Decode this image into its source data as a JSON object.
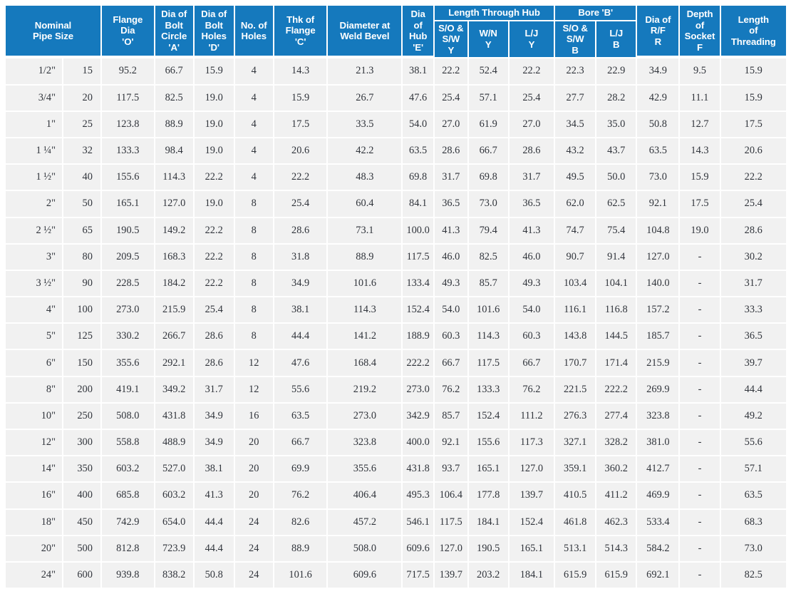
{
  "table": {
    "header": {
      "nominal_pipe_size": "Nominal\nPipe Size",
      "nominal_pipe_size_line1": "Nominal",
      "nominal_pipe_size_line2": "Pipe Size",
      "flange_dia": "Flange\nDia\n'O'",
      "flange_dia_l1": "Flange",
      "flange_dia_l2": "Dia",
      "flange_dia_l3": "'O'",
      "bolt_circle_l1": "Dia of",
      "bolt_circle_l2": "Bolt",
      "bolt_circle_l3": "Circle",
      "bolt_circle_l4": "'A'",
      "bolt_holes_l1": "Dia of",
      "bolt_holes_l2": "Bolt",
      "bolt_holes_l3": "Holes",
      "bolt_holes_l4": "'D'",
      "no_holes_l1": "No. of",
      "no_holes_l2": "Holes",
      "thk_flange_l1": "Thk of",
      "thk_flange_l2": "Flange",
      "thk_flange_l3": "'C'",
      "weld_bevel_l1": "Diameter at",
      "weld_bevel_l2": "Weld Bevel",
      "dia_hub_l1": "Dia",
      "dia_hub_l2": "of",
      "dia_hub_l3": "Hub",
      "dia_hub_l4": "'E'",
      "length_through_hub_group": "Length Through Hub",
      "bore_group": "Bore 'B'",
      "lth_sosw_l1": "S/O &",
      "lth_sosw_l2": "S/W",
      "lth_sosw_l3": "Y",
      "lth_wn_l1": "W/N",
      "lth_wn_l2": "Y",
      "lth_lj_l1": "L/J",
      "lth_lj_l2": "Y",
      "bore_sosw_l1": "S/O &",
      "bore_sosw_l2": "S/W",
      "bore_sosw_l3": "B",
      "bore_lj_l1": "L/J",
      "bore_lj_l2": "B",
      "rf_l1": "Dia of",
      "rf_l2": "R/F",
      "rf_l3": "R",
      "socket_l1": "Depth",
      "socket_l2": "of",
      "socket_l3": "Socket",
      "socket_l4": "F",
      "thread_l1": "Length",
      "thread_l2": "of",
      "thread_l3": "Threading"
    },
    "columns": [
      "Nominal Pipe Size (inch)",
      "Nominal Pipe Size (mm)",
      "Flange Dia 'O'",
      "Dia of Bolt Circle 'A'",
      "Dia of Bolt Holes 'D'",
      "No. of Holes",
      "Thk of Flange 'C'",
      "Diameter at Weld Bevel",
      "Dia of Hub 'E'",
      "Length Through Hub S/O & S/W Y",
      "Length Through Hub W/N Y",
      "Length Through Hub L/J Y",
      "Bore 'B' S/O & S/W B",
      "Bore 'B' L/J B",
      "Dia of R/F R",
      "Depth of Socket F",
      "Length of Threading"
    ],
    "rows": [
      [
        "1/2\"",
        "15",
        "95.2",
        "66.7",
        "15.9",
        "4",
        "14.3",
        "21.3",
        "38.1",
        "22.2",
        "52.4",
        "22.2",
        "22.3",
        "22.9",
        "34.9",
        "9.5",
        "15.9"
      ],
      [
        "3/4\"",
        "20",
        "117.5",
        "82.5",
        "19.0",
        "4",
        "15.9",
        "26.7",
        "47.6",
        "25.4",
        "57.1",
        "25.4",
        "27.7",
        "28.2",
        "42.9",
        "11.1",
        "15.9"
      ],
      [
        "1\"",
        "25",
        "123.8",
        "88.9",
        "19.0",
        "4",
        "17.5",
        "33.5",
        "54.0",
        "27.0",
        "61.9",
        "27.0",
        "34.5",
        "35.0",
        "50.8",
        "12.7",
        "17.5"
      ],
      [
        "1 ¼\"",
        "32",
        "133.3",
        "98.4",
        "19.0",
        "4",
        "20.6",
        "42.2",
        "63.5",
        "28.6",
        "66.7",
        "28.6",
        "43.2",
        "43.7",
        "63.5",
        "14.3",
        "20.6"
      ],
      [
        "1 ½\"",
        "40",
        "155.6",
        "114.3",
        "22.2",
        "4",
        "22.2",
        "48.3",
        "69.8",
        "31.7",
        "69.8",
        "31.7",
        "49.5",
        "50.0",
        "73.0",
        "15.9",
        "22.2"
      ],
      [
        "2\"",
        "50",
        "165.1",
        "127.0",
        "19.0",
        "8",
        "25.4",
        "60.4",
        "84.1",
        "36.5",
        "73.0",
        "36.5",
        "62.0",
        "62.5",
        "92.1",
        "17.5",
        "25.4"
      ],
      [
        "2 ½\"",
        "65",
        "190.5",
        "149.2",
        "22.2",
        "8",
        "28.6",
        "73.1",
        "100.0",
        "41.3",
        "79.4",
        "41.3",
        "74.7",
        "75.4",
        "104.8",
        "19.0",
        "28.6"
      ],
      [
        "3\"",
        "80",
        "209.5",
        "168.3",
        "22.2",
        "8",
        "31.8",
        "88.9",
        "117.5",
        "46.0",
        "82.5",
        "46.0",
        "90.7",
        "91.4",
        "127.0",
        "-",
        "30.2"
      ],
      [
        "3 ½\"",
        "90",
        "228.5",
        "184.2",
        "22.2",
        "8",
        "34.9",
        "101.6",
        "133.4",
        "49.3",
        "85.7",
        "49.3",
        "103.4",
        "104.1",
        "140.0",
        "-",
        "31.7"
      ],
      [
        "4\"",
        "100",
        "273.0",
        "215.9",
        "25.4",
        "8",
        "38.1",
        "114.3",
        "152.4",
        "54.0",
        "101.6",
        "54.0",
        "116.1",
        "116.8",
        "157.2",
        "-",
        "33.3"
      ],
      [
        "5\"",
        "125",
        "330.2",
        "266.7",
        "28.6",
        "8",
        "44.4",
        "141.2",
        "188.9",
        "60.3",
        "114.3",
        "60.3",
        "143.8",
        "144.5",
        "185.7",
        "-",
        "36.5"
      ],
      [
        "6\"",
        "150",
        "355.6",
        "292.1",
        "28.6",
        "12",
        "47.6",
        "168.4",
        "222.2",
        "66.7",
        "117.5",
        "66.7",
        "170.7",
        "171.4",
        "215.9",
        "-",
        "39.7"
      ],
      [
        "8\"",
        "200",
        "419.1",
        "349.2",
        "31.7",
        "12",
        "55.6",
        "219.2",
        "273.0",
        "76.2",
        "133.3",
        "76.2",
        "221.5",
        "222.2",
        "269.9",
        "-",
        "44.4"
      ],
      [
        "10\"",
        "250",
        "508.0",
        "431.8",
        "34.9",
        "16",
        "63.5",
        "273.0",
        "342.9",
        "85.7",
        "152.4",
        "111.2",
        "276.3",
        "277.4",
        "323.8",
        "-",
        "49.2"
      ],
      [
        "12\"",
        "300",
        "558.8",
        "488.9",
        "34.9",
        "20",
        "66.7",
        "323.8",
        "400.0",
        "92.1",
        "155.6",
        "117.3",
        "327.1",
        "328.2",
        "381.0",
        "-",
        "55.6"
      ],
      [
        "14\"",
        "350",
        "603.2",
        "527.0",
        "38.1",
        "20",
        "69.9",
        "355.6",
        "431.8",
        "93.7",
        "165.1",
        "127.0",
        "359.1",
        "360.2",
        "412.7",
        "-",
        "57.1"
      ],
      [
        "16\"",
        "400",
        "685.8",
        "603.2",
        "41.3",
        "20",
        "76.2",
        "406.4",
        "495.3",
        "106.4",
        "177.8",
        "139.7",
        "410.5",
        "411.2",
        "469.9",
        "-",
        "63.5"
      ],
      [
        "18\"",
        "450",
        "742.9",
        "654.0",
        "44.4",
        "24",
        "82.6",
        "457.2",
        "546.1",
        "117.5",
        "184.1",
        "152.4",
        "461.8",
        "462.3",
        "533.4",
        "-",
        "68.3"
      ],
      [
        "20\"",
        "500",
        "812.8",
        "723.9",
        "44.4",
        "24",
        "88.9",
        "508.0",
        "609.6",
        "127.0",
        "190.5",
        "165.1",
        "513.1",
        "514.3",
        "584.2",
        "-",
        "73.0"
      ],
      [
        "24\"",
        "600",
        "939.8",
        "838.2",
        "50.8",
        "24",
        "101.6",
        "609.6",
        "717.5",
        "139.7",
        "203.2",
        "184.1",
        "615.9",
        "615.9",
        "692.1",
        "-",
        "82.5"
      ]
    ]
  },
  "colors": {
    "header_background": "#1579bd",
    "header_text": "#ffffff",
    "cell_background": "#f1f1f1",
    "cell_text": "#30343b",
    "gridline": "#ffffff",
    "page_background": "#ffffff"
  }
}
